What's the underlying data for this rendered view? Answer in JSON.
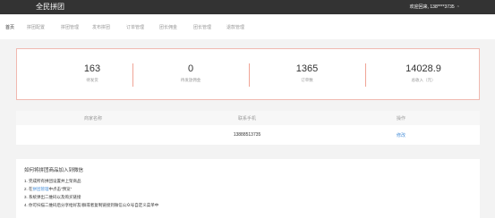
{
  "header": {
    "brand": "全民拼团",
    "welcome": "欢迎回来, 138****3735"
  },
  "tabs": [
    {
      "label": "首页",
      "active": true
    },
    {
      "label": "拼团配置",
      "active": false
    },
    {
      "label": "拼团管理",
      "active": false
    },
    {
      "label": "发布拼团",
      "active": false
    },
    {
      "label": "订单管理",
      "active": false
    },
    {
      "label": "团长佣金",
      "active": false
    },
    {
      "label": "团长管理",
      "active": false
    },
    {
      "label": "退款管理",
      "active": false
    }
  ],
  "stats": [
    {
      "value": "163",
      "label": "待发货"
    },
    {
      "value": "0",
      "label": "待发放佣金"
    },
    {
      "value": "1365",
      "label": "订单数"
    },
    {
      "value": "14028.9",
      "label": "总收入（元）"
    }
  ],
  "table": {
    "headers": [
      "商家名称",
      "联系手机",
      "操作"
    ],
    "row": {
      "name": "",
      "phone": "13888513735",
      "action": "修改"
    }
  },
  "howto": {
    "title": "如何将拼团商品加入到微信",
    "steps": [
      {
        "prefix": "1. 完成所有拼团设置并上架商品",
        "link": "",
        "suffix": ""
      },
      {
        "prefix": "2. 在",
        "link": "拼团管理",
        "suffix": "中点击\"预览\""
      },
      {
        "prefix": "3. 系统弹出二维码以及购买链接",
        "link": "",
        "suffix": ""
      },
      {
        "prefix": "4. 你可扫描二维码后分享给好友/群或者复制链接到微信公众号自定义菜单中",
        "link": "",
        "suffix": ""
      }
    ]
  }
}
